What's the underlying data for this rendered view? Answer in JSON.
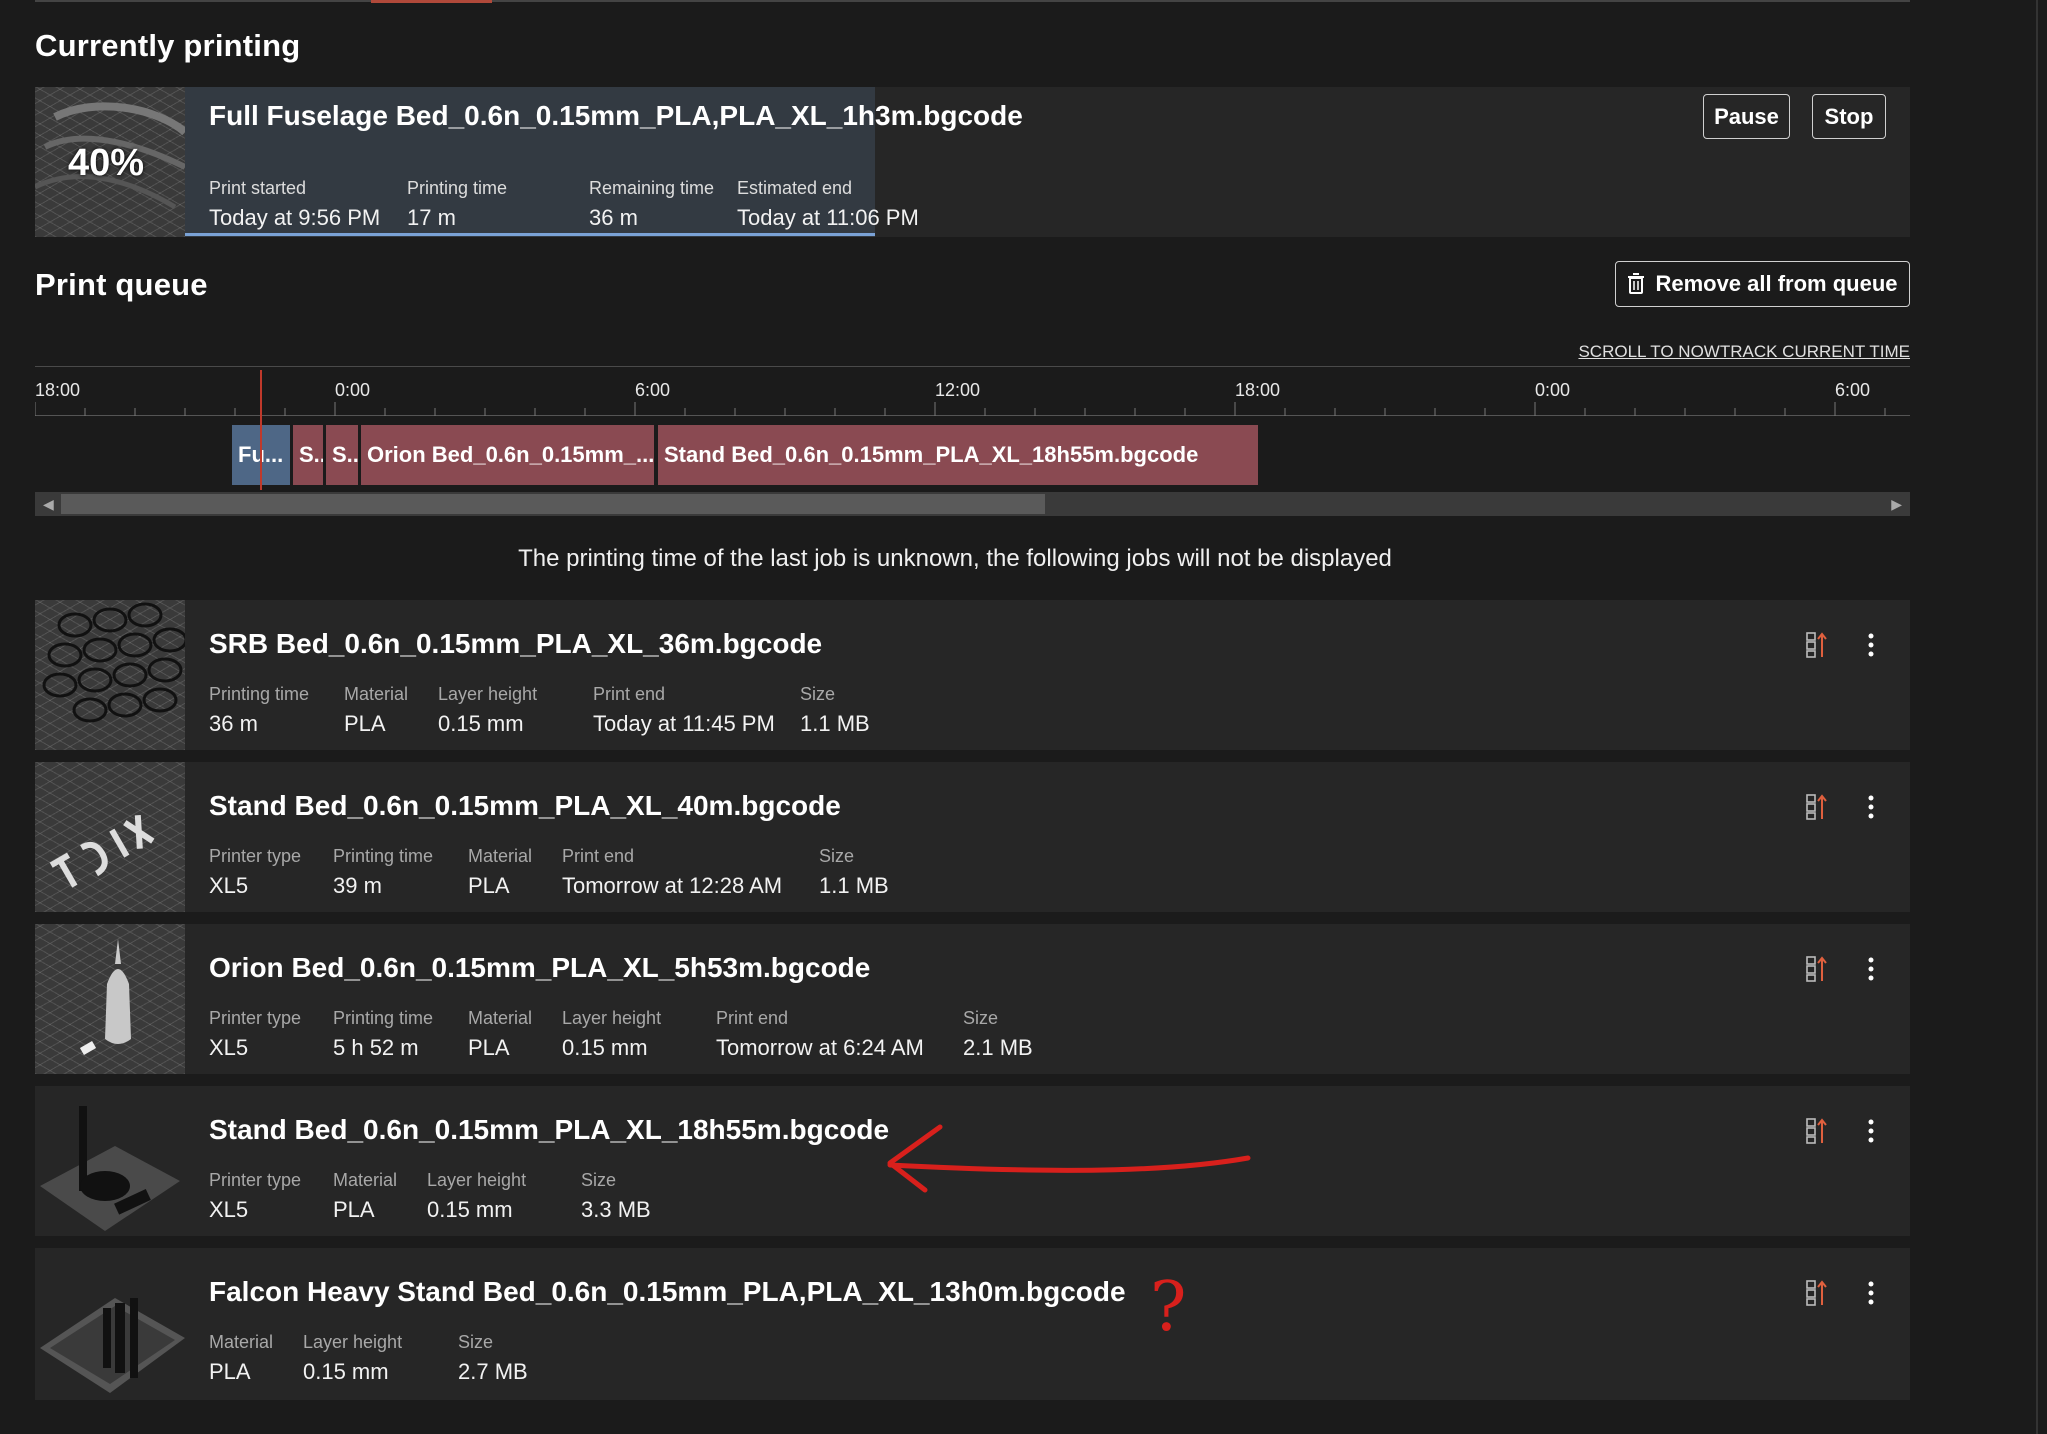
{
  "current": {
    "heading": "Currently printing",
    "file": "Full Fuselage Bed_0.6n_0.15mm_PLA,PLA_XL_1h3m.bgcode",
    "progress_label": "40%",
    "progress": 0.4,
    "pause_label": "Pause",
    "stop_label": "Stop",
    "stats": [
      {
        "label": "Print started",
        "value": "Today at 9:56 PM"
      },
      {
        "label": "Printing time",
        "value": "17 m"
      },
      {
        "label": "Remaining time",
        "value": "36 m"
      },
      {
        "label": "Estimated end",
        "value": "Today at 11:06 PM"
      }
    ]
  },
  "queue": {
    "heading": "Print queue",
    "remove_all_label": "Remove all from queue",
    "scroll_link": "SCROLL TO NOWTRACK CURRENT TIME",
    "timeline_ticks": [
      "18:00",
      "0:00",
      "6:00",
      "12:00",
      "18:00",
      "0:00",
      "6:00"
    ],
    "timeline_jobs": [
      {
        "label": "Fu...",
        "color": "#4e6786"
      },
      {
        "label": "S...",
        "color": "#8a4a52"
      },
      {
        "label": "S...",
        "color": "#8a4a52"
      },
      {
        "label": "Orion Bed_0.6n_0.15mm_...",
        "color": "#8a4a52"
      },
      {
        "label": "Stand Bed_0.6n_0.15mm_PLA_XL_18h55m.bgcode",
        "color": "#8a4a52"
      }
    ],
    "notice": "The printing time of the last job is unknown, the following jobs will not be displayed",
    "items": [
      {
        "file": "SRB Bed_0.6n_0.15mm_PLA_XL_36m.bgcode",
        "stats": [
          {
            "label": "Printing time",
            "value": "36 m"
          },
          {
            "label": "Material",
            "value": "PLA"
          },
          {
            "label": "Layer height",
            "value": "0.15 mm"
          },
          {
            "label": "Print end",
            "value": "Today at 11:45 PM"
          },
          {
            "label": "Size",
            "value": "1.1 MB"
          }
        ]
      },
      {
        "file": "Stand Bed_0.6n_0.15mm_PLA_XL_40m.bgcode",
        "stats": [
          {
            "label": "Printer type",
            "value": "XL5"
          },
          {
            "label": "Printing time",
            "value": "39 m"
          },
          {
            "label": "Material",
            "value": "PLA"
          },
          {
            "label": "Print end",
            "value": "Tomorrow at 12:28 AM"
          },
          {
            "label": "Size",
            "value": "1.1 MB"
          }
        ]
      },
      {
        "file": "Orion Bed_0.6n_0.15mm_PLA_XL_5h53m.bgcode",
        "stats": [
          {
            "label": "Printer type",
            "value": "XL5"
          },
          {
            "label": "Printing time",
            "value": "5 h 52 m"
          },
          {
            "label": "Material",
            "value": "PLA"
          },
          {
            "label": "Layer height",
            "value": "0.15 mm"
          },
          {
            "label": "Print end",
            "value": "Tomorrow at 6:24 AM"
          },
          {
            "label": "Size",
            "value": "2.1 MB"
          }
        ]
      },
      {
        "file": "Stand Bed_0.6n_0.15mm_PLA_XL_18h55m.bgcode",
        "stats": [
          {
            "label": "Printer type",
            "value": "XL5"
          },
          {
            "label": "Material",
            "value": "PLA"
          },
          {
            "label": "Layer height",
            "value": "0.15 mm"
          },
          {
            "label": "Size",
            "value": "3.3 MB"
          }
        ]
      },
      {
        "file": "Falcon Heavy Stand Bed_0.6n_0.15mm_PLA,PLA_XL_13h0m.bgcode",
        "stats": [
          {
            "label": "Material",
            "value": "PLA"
          },
          {
            "label": "Layer height",
            "value": "0.15 mm"
          },
          {
            "label": "Size",
            "value": "2.7 MB"
          }
        ]
      }
    ]
  },
  "annotations": {
    "question_mark": "?"
  },
  "icons": {
    "reorder": "move-to-top-icon",
    "menu": "more-vertical-icon",
    "trash": "trash-icon"
  },
  "colors": {
    "background": "#1b1b1b",
    "card": "#262626",
    "progress_fill": "#333a42",
    "progress_line": "#7aa2d6",
    "current_job": "#4e6786",
    "queued_job": "#8a4a52",
    "accent": "#e0603e",
    "annotation": "#d8201c"
  }
}
